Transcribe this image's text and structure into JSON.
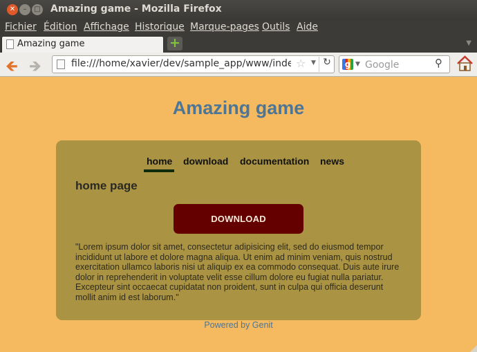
{
  "window": {
    "title": "Amazing game - Mozilla Firefox",
    "controls": [
      "close",
      "minimize",
      "maximize"
    ]
  },
  "menu": {
    "items": [
      "Fichier",
      "Édition",
      "Affichage",
      "Historique",
      "Marque-pages",
      "Outils",
      "Aide"
    ]
  },
  "tabs": [
    {
      "label": "Amazing game",
      "icon": "document-icon",
      "active": true
    }
  ],
  "new_tab": {
    "label": "+"
  },
  "toolbar": {
    "url": "file:///home/xavier/dev/sample_app/www/index.html",
    "search_placeholder": "Google",
    "search_engine_icon": "google-icon"
  },
  "page": {
    "title": "Amazing game",
    "nav": [
      "home",
      "download",
      "documentation",
      "news"
    ],
    "active_nav": "home",
    "section_title": "home page",
    "download_button": "DOWNLOAD",
    "lorem": "\"Lorem ipsum dolor sit amet, consectetur adipisicing elit, sed do eiusmod tempor incididunt ut labore et dolore magna aliqua. Ut enim ad minim veniam, quis nostrud exercitation ullamco laboris nisi ut aliquip ex ea commodo consequat. Duis aute irure dolor in reprehenderit in voluptate velit esse cillum dolore eu fugiat nulla pariatur. Excepteur sint occaecat cupidatat non proident, sunt in culpa qui officia deserunt mollit anim id est laborum.\"",
    "footer": "Powered by Genit"
  },
  "colors": {
    "page_background": "#f5b960",
    "panel": "#aa9443",
    "title_blue": "#4c7596",
    "download_button": "#640000",
    "nav_underline": "#0f2a0a"
  }
}
